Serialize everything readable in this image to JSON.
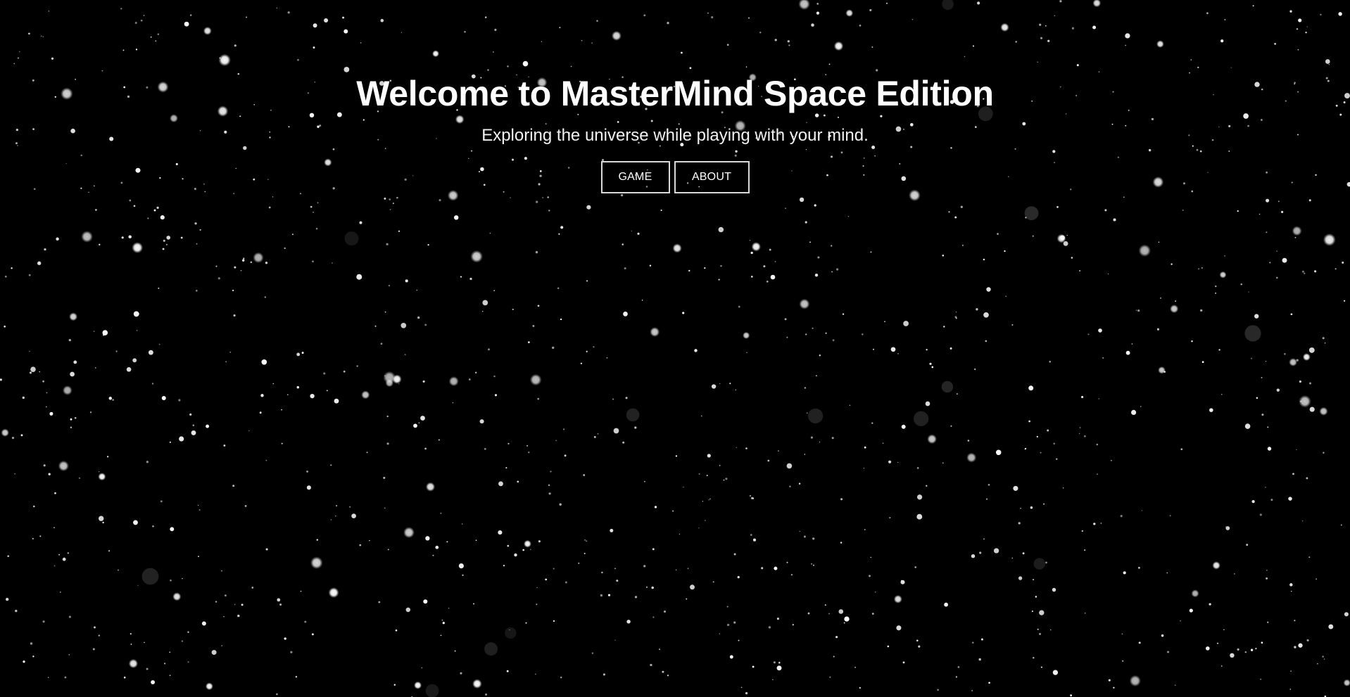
{
  "hero": {
    "title": "Welcome to MasterMind Space Edition",
    "subtitle": "Exploring the universe while playing with your mind."
  },
  "nav": {
    "game_label": "GAME",
    "about_label": "ABOUT"
  },
  "colors": {
    "background": "#000000",
    "text": "#ffffff",
    "star": "#ffffff",
    "button_border": "#d9d9d9"
  }
}
